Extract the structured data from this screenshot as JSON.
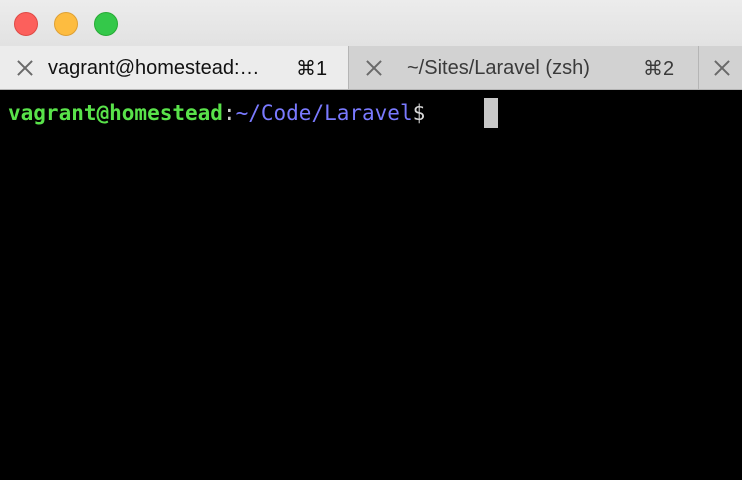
{
  "titlebar": {
    "buttons": [
      "close",
      "minimize",
      "zoom"
    ]
  },
  "tabs": [
    {
      "title": "vagrant@homestead:…",
      "shortcut": "⌘1",
      "active": true
    },
    {
      "title": "~/Sites/Laravel (zsh)",
      "shortcut": "⌘2",
      "active": false
    }
  ],
  "terminal": {
    "prompt_user": "vagrant@homestead",
    "prompt_sep": ":",
    "prompt_path": "~/Code/Laravel",
    "prompt_symbol": "$"
  },
  "colors": {
    "user": "#59e24a",
    "path": "#7a7aff",
    "background": "#000000"
  }
}
